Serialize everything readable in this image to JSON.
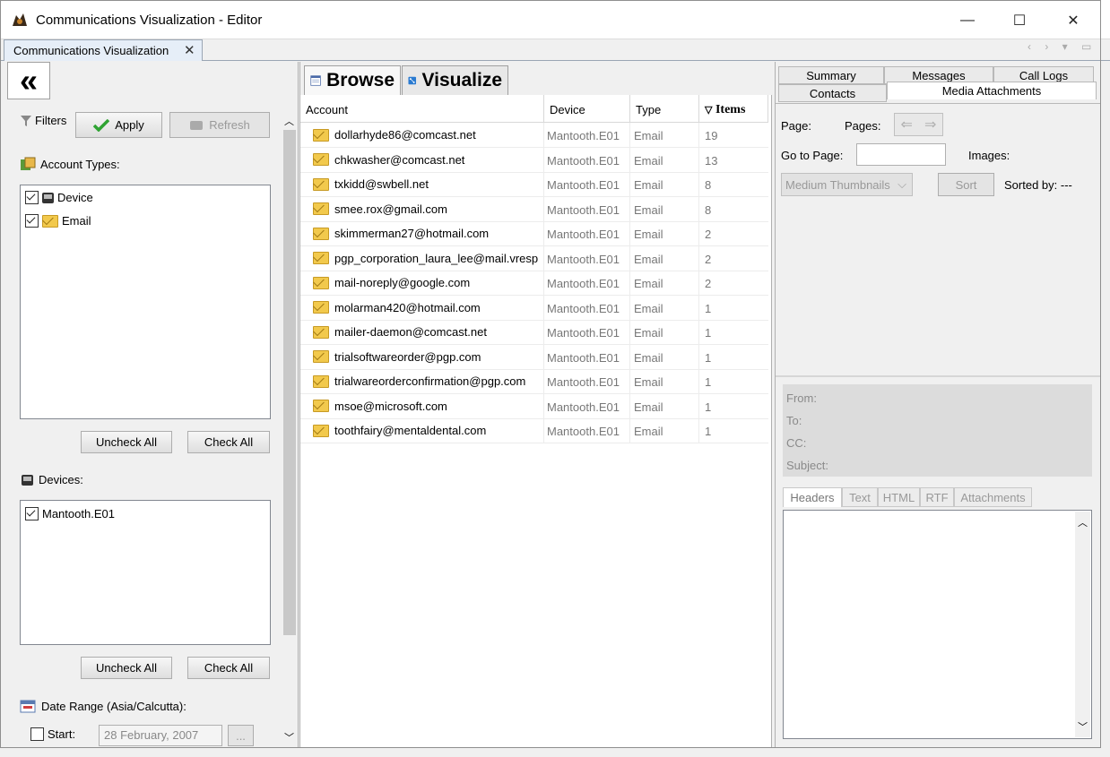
{
  "window": {
    "title": "Communications Visualization - Editor",
    "min": "—",
    "max": "☐",
    "close": "✕"
  },
  "doc_tab": {
    "label": "Communications Visualization",
    "close": "✕"
  },
  "tab_nav": "‹ › ▾ ▭",
  "left": {
    "collapse": "«",
    "filters_label": "Filters",
    "apply_label": "Apply",
    "refresh_label": "Refresh",
    "account_types_label": "Account Types:",
    "account_types": [
      {
        "label": "Device",
        "checked": true
      },
      {
        "label": "Email",
        "checked": true
      }
    ],
    "uncheck_all": "Uncheck All",
    "check_all": "Check All",
    "devices_label": "Devices:",
    "devices": [
      {
        "label": "Mantooth.E01",
        "checked": true
      }
    ],
    "date_range_label": "Date Range (Asia/Calcutta):",
    "start_label": "Start:",
    "start_value": "28 February, 2007",
    "date_picker": "..."
  },
  "middle": {
    "tabs": {
      "browse": "Browse",
      "visualize": "Visualize"
    },
    "columns": {
      "account": "Account",
      "device": "Device",
      "type": "Type",
      "items": "Items",
      "sort_indicator": "▽"
    },
    "rows": [
      {
        "account": "dollarhyde86@comcast.net",
        "device": "Mantooth.E01",
        "type": "Email",
        "items": "19"
      },
      {
        "account": "chkwasher@comcast.net",
        "device": "Mantooth.E01",
        "type": "Email",
        "items": "13"
      },
      {
        "account": "txkidd@swbell.net",
        "device": "Mantooth.E01",
        "type": "Email",
        "items": "8"
      },
      {
        "account": "smee.rox@gmail.com",
        "device": "Mantooth.E01",
        "type": "Email",
        "items": "8"
      },
      {
        "account": "skimmerman27@hotmail.com",
        "device": "Mantooth.E01",
        "type": "Email",
        "items": "2"
      },
      {
        "account": "pgp_corporation_laura_lee@mail.vresp",
        "device": "Mantooth.E01",
        "type": "Email",
        "items": "2"
      },
      {
        "account": "mail-noreply@google.com",
        "device": "Mantooth.E01",
        "type": "Email",
        "items": "2"
      },
      {
        "account": "molarman420@hotmail.com",
        "device": "Mantooth.E01",
        "type": "Email",
        "items": "1"
      },
      {
        "account": "mailer-daemon@comcast.net",
        "device": "Mantooth.E01",
        "type": "Email",
        "items": "1"
      },
      {
        "account": "trialsoftwareorder@pgp.com",
        "device": "Mantooth.E01",
        "type": "Email",
        "items": "1"
      },
      {
        "account": "trialwareorderconfirmation@pgp.com",
        "device": "Mantooth.E01",
        "type": "Email",
        "items": "1"
      },
      {
        "account": "msoe@microsoft.com",
        "device": "Mantooth.E01",
        "type": "Email",
        "items": "1"
      },
      {
        "account": "toothfairy@mentaldental.com",
        "device": "Mantooth.E01",
        "type": "Email",
        "items": "1"
      }
    ]
  },
  "right": {
    "tabs": {
      "summary": "Summary",
      "messages": "Messages",
      "call_logs": "Call Logs",
      "contacts": "Contacts",
      "media_attachments": "Media Attachments"
    },
    "page_label": "Page:",
    "pages_label": "Pages:",
    "goto_label": "Go to Page:",
    "images_label": "Images:",
    "thumb_select": "Medium Thumbnails",
    "sort_label": "Sort",
    "sorted_by": "Sorted by: ---",
    "hdr": {
      "from": "From:",
      "to": "To:",
      "cc": "CC:",
      "subject": "Subject:"
    },
    "subtabs": {
      "headers": "Headers",
      "text": "Text",
      "html": "HTML",
      "rtf": "RTF",
      "attachments": "Attachments"
    }
  }
}
